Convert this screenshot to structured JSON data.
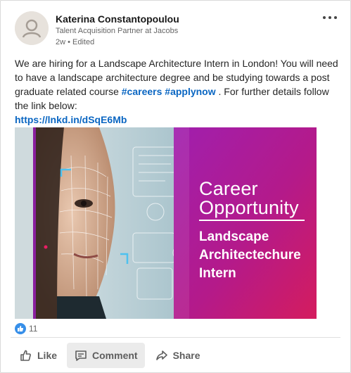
{
  "post": {
    "author": {
      "name": "Katerina Constantopoulou",
      "headline": "Talent Acquisition Partner at Jacobs",
      "meta": "2w • Edited"
    },
    "text_main": "We are hiring for a Landscape Architecture Intern in London! You will need to have a landscape architecture degree and be studying towards a post graduate related course ",
    "hashtags": [
      "#careers",
      "#applynow"
    ],
    "text_after": " . For further details follow the link below:",
    "link": "https://lnkd.in/dSqE6Mb"
  },
  "image": {
    "line1": "Career",
    "line2": "Opportunity",
    "role_line1": "Landscape",
    "role_line2": "Architectechure",
    "role_line3": "Intern"
  },
  "social": {
    "reaction_count": "11"
  },
  "actions": {
    "like": "Like",
    "comment": "Comment",
    "share": "Share"
  },
  "colors": {
    "link": "#0a66c2",
    "brand_purple": "#8a1f9e",
    "brand_pink": "#c2185b",
    "like_blue": "#378fe9"
  },
  "icons": [
    "avatar-placeholder-icon",
    "more-options-icon",
    "like-reaction-icon",
    "thumbs-up-icon",
    "comment-icon",
    "share-icon"
  ]
}
